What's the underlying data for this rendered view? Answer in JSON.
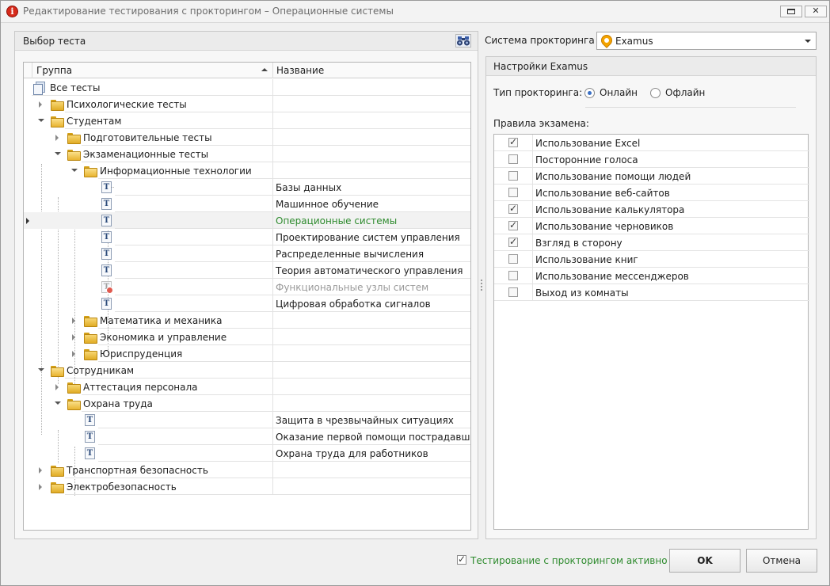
{
  "window": {
    "title": "Редактирование тестирования с прокторингом  –  Операционные системы",
    "close_glyph": "✕"
  },
  "test_select": {
    "header": "Выбор теста",
    "columns": {
      "group": "Группа",
      "name": "Название"
    },
    "rows": [
      {
        "label": "Все тесты",
        "name": ""
      },
      {
        "label": "Психологические тесты",
        "name": ""
      },
      {
        "label": "Студентам",
        "name": ""
      },
      {
        "label": "Подготовительные тесты",
        "name": ""
      },
      {
        "label": "Экзаменационные тесты",
        "name": ""
      },
      {
        "label": "Информационные технологии",
        "name": ""
      },
      {
        "label": "",
        "name": "Базы данных"
      },
      {
        "label": "",
        "name": "Машинное обучение"
      },
      {
        "label": "",
        "name": "Операционные системы"
      },
      {
        "label": "",
        "name": "Проектирование систем управления"
      },
      {
        "label": "",
        "name": "Распределенные вычисления"
      },
      {
        "label": "",
        "name": "Теория автоматического управления"
      },
      {
        "label": "",
        "name": "Функциональные узлы систем"
      },
      {
        "label": "",
        "name": "Цифровая обработка сигналов"
      },
      {
        "label": "Математика и механика",
        "name": ""
      },
      {
        "label": "Экономика и управление",
        "name": ""
      },
      {
        "label": "Юриспруденция",
        "name": ""
      },
      {
        "label": "Сотрудникам",
        "name": ""
      },
      {
        "label": "Аттестация персонала",
        "name": ""
      },
      {
        "label": "Охрана труда",
        "name": ""
      },
      {
        "label": "",
        "name": "Защита в чрезвычайных ситуациях"
      },
      {
        "label": "",
        "name": "Оказание первой помощи пострадавшим"
      },
      {
        "label": "",
        "name": "Охрана труда для работников"
      },
      {
        "label": "Транспортная безопасность",
        "name": ""
      },
      {
        "label": "Электробезопасность",
        "name": ""
      }
    ]
  },
  "proctoring": {
    "system_label": "Система прокторинга",
    "system_value": "Examus",
    "settings_header": "Настройки Examus",
    "type_label": "Тип прокторинга:",
    "type_options": [
      "Онлайн",
      "Офлайн"
    ],
    "type_selected": "Онлайн",
    "rules_label": "Правила экзамена:",
    "rules": [
      {
        "text": "Использование Excel",
        "checked": true
      },
      {
        "text": "Посторонние голоса",
        "checked": false
      },
      {
        "text": "Использование помощи людей",
        "checked": false
      },
      {
        "text": "Использование веб-сайтов",
        "checked": false
      },
      {
        "text": "Использование калькулятора",
        "checked": true
      },
      {
        "text": "Использование черновиков",
        "checked": true
      },
      {
        "text": "Взгляд в сторону",
        "checked": true
      },
      {
        "text": "Использование книг",
        "checked": false
      },
      {
        "text": "Использование мессенджеров",
        "checked": false
      },
      {
        "text": "Выход из комнаты",
        "checked": false
      }
    ],
    "check_glyph": "✓"
  },
  "footer": {
    "active_label": "Тестирование с прокторингом активно",
    "active_checked": true,
    "ok_label": "OK",
    "cancel_label": "Отмена"
  },
  "colors": {
    "highlight": "#2e8b2e",
    "disabled": "#9a9a9a",
    "accent": "#3a6fc4"
  }
}
